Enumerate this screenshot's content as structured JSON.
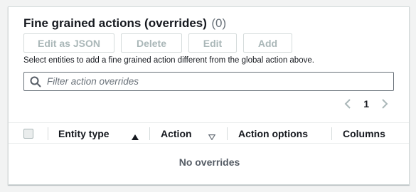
{
  "header": {
    "title": "Fine grained actions (overrides)",
    "count": "(0)"
  },
  "buttons": {
    "edit_json": "Edit as JSON",
    "delete": "Delete",
    "edit": "Edit",
    "add": "Add"
  },
  "description": "Select entities to add a fine grained action different from the global action above.",
  "filter": {
    "placeholder": "Filter action overrides",
    "value": ""
  },
  "pagination": {
    "current_page": "1"
  },
  "table": {
    "columns": [
      "Entity type",
      "Action",
      "Action options",
      "Columns"
    ],
    "empty_text": "No overrides"
  },
  "colors": {
    "disabled_text": "#aab7b8",
    "border": "#d5dbdb",
    "text": "#16191f"
  },
  "icons": [
    "search-icon",
    "chevron-left-icon",
    "chevron-right-icon",
    "sort-ascending-icon",
    "sort-descending-icon"
  ]
}
